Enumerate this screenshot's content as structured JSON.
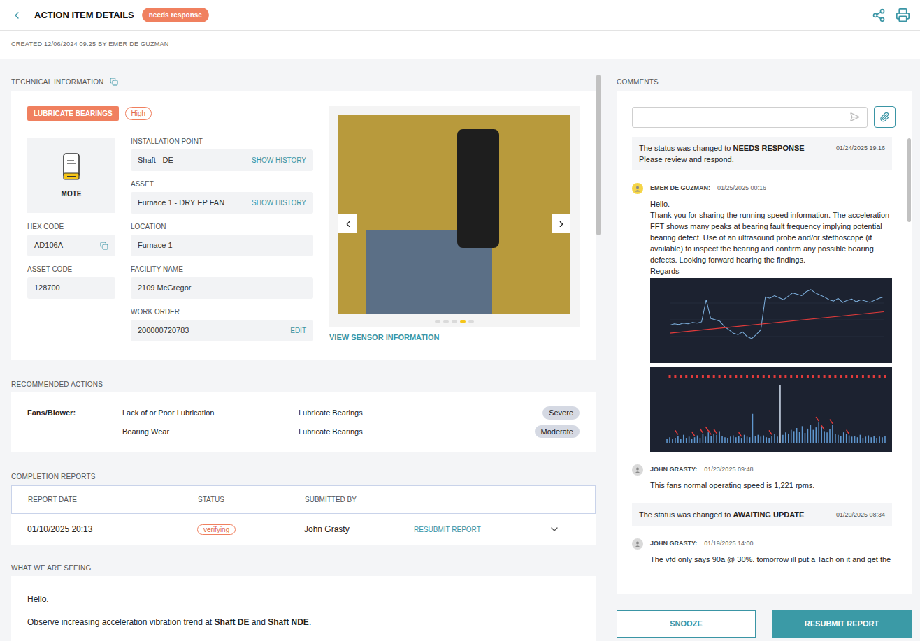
{
  "header": {
    "title": "ACTION ITEM DETAILS",
    "status": "needs response"
  },
  "created": "CREATED 12/06/2024 09:25 BY EMER DE GUZMAN",
  "technical": {
    "label": "TECHNICAL INFORMATION",
    "action": "LUBRICATE BEARINGS",
    "priority": "High",
    "device": "MOTE",
    "left_fields": [
      {
        "label": "HEX CODE",
        "value": "AD106A",
        "copyable": true
      },
      {
        "label": "ASSET CODE",
        "value": "128700",
        "copyable": false
      }
    ],
    "fields": [
      {
        "label": "INSTALLATION POINT",
        "value": "Shaft - DE",
        "link": "SHOW HISTORY"
      },
      {
        "label": "ASSET",
        "value": "Furnace 1 - DRY EP FAN",
        "link": "SHOW HISTORY"
      },
      {
        "label": "LOCATION",
        "value": "Furnace 1",
        "link": ""
      },
      {
        "label": "FACILITY NAME",
        "value": "2109 McGregor",
        "link": ""
      },
      {
        "label": "WORK ORDER",
        "value": "200000720783",
        "link": "EDIT"
      }
    ],
    "photo": {
      "slides": [
        {
          "selected": false
        },
        {
          "selected": false
        },
        {
          "selected": false
        },
        {
          "selected": true
        },
        {
          "selected": false
        }
      ],
      "link": "VIEW SENSOR INFORMATION"
    }
  },
  "recommended": {
    "label": "RECOMMENDED ACTIONS",
    "category": "Fans/Blower:",
    "rows": [
      {
        "issue": "Lack of or Poor Lubrication",
        "action": "Lubricate Bearings",
        "severity": "Severe"
      },
      {
        "issue": "Bearing Wear",
        "action": "Lubricate Bearings",
        "severity": "Moderate"
      }
    ]
  },
  "completion": {
    "label": "COMPLETION REPORTS",
    "columns": [
      "REPORT DATE",
      "STATUS",
      "SUBMITTED BY"
    ],
    "rows": [
      {
        "date": "01/10/2025 20:13",
        "status": "verifying",
        "submitted_by": "John Grasty",
        "action": "RESUBMIT REPORT",
        "expanded": false
      }
    ]
  },
  "seeing": {
    "label": "WHAT WE ARE SEEING",
    "greeting": "Hello.",
    "segments": [
      {
        "text": "Observe increasing acceleration vibration trend at ",
        "bold": false
      },
      {
        "text": "Shaft DE",
        "bold": true
      },
      {
        "text": " and ",
        "bold": false
      },
      {
        "text": "Shaft NDE",
        "bold": true
      },
      {
        "text": ".",
        "bold": false
      }
    ]
  },
  "comments": {
    "label": "COMMENTS",
    "input": "",
    "items": [
      {
        "kind": "status",
        "prefix": "The status was changed to ",
        "status": "NEEDS RESPONSE",
        "date": "01/24/2025 19:16",
        "note": "Please review and respond."
      },
      {
        "kind": "user",
        "author": "EMER DE GUZMAN:",
        "date": "01/25/2025 00:16",
        "avatar_color": "#f5d547",
        "paragraphs": [
          "Hello.",
          "Thank you for sharing the running speed information. The acceleration FFT shows many peaks at bearing fault frequency implying potential bearing defect. Use of an ultrasound probe and/or stethoscope (if available) to inspect the bearing and confirm any possible bearing defects. Looking forward hearing the findings.",
          "Regards"
        ],
        "charts": [
          {
            "type": "trend",
            "series": [
              42,
              44,
              43,
              45,
              44,
              46,
              45,
              47,
              80,
              52,
              50,
              48,
              40,
              35,
              30,
              28,
              32,
              25,
              22,
              28,
              35,
              84,
              82,
              86,
              83,
              80,
              85,
              90,
              88,
              86,
              92,
              95,
              90,
              87,
              84,
              80,
              78,
              82,
              76,
              79,
              81,
              77,
              80,
              78,
              76,
              79,
              82,
              84
            ],
            "trend": [
              30,
              62
            ]
          },
          {
            "type": "spectrum",
            "series": [
              8,
              10,
              7,
              9,
              12,
              8,
              14,
              9,
              11,
              8,
              10,
              13,
              9,
              15,
              11,
              18,
              12,
              16,
              14,
              20,
              12,
              10,
              9,
              11,
              13,
              10,
              12,
              9,
              14,
              11,
              10,
              48,
              12,
              14,
              11,
              13,
              10,
              9,
              12,
              15,
              11,
              95,
              14,
              18,
              16,
              22,
              20,
              25,
              19,
              28,
              17,
              24,
              30,
              22,
              26,
              34,
              28,
              20,
              18,
              24,
              30,
              16,
              14,
              12,
              18,
              15,
              13,
              11,
              12,
              10,
              14,
              9,
              11,
              13,
              10,
              12,
              9,
              11,
              10,
              12
            ],
            "arrows": [
              4,
              10,
              13,
              15,
              16,
              18,
              27,
              38,
              55,
              57,
              60,
              66
            ],
            "cursors": [
              1,
              3,
              5,
              7,
              9,
              11,
              13,
              15,
              17,
              19,
              21,
              23,
              25,
              27,
              29,
              31,
              33,
              35,
              37,
              39,
              41,
              43,
              45,
              47,
              49,
              51,
              53,
              55,
              57,
              59,
              61,
              63,
              65,
              67,
              69,
              71,
              73,
              75,
              77,
              79
            ]
          }
        ]
      },
      {
        "kind": "user",
        "author": "JOHN GRASTY:",
        "date": "01/23/2025 09:48",
        "avatar_color": "#d9d9d9",
        "paragraphs": [
          "This fans normal operating speed is 1,221 rpms."
        ],
        "charts": []
      },
      {
        "kind": "status",
        "prefix": "The status was changed to ",
        "status": "AWAITING UPDATE",
        "date": "01/20/2025 08:34",
        "note": ""
      },
      {
        "kind": "user",
        "author": "JOHN GRASTY:",
        "date": "01/19/2025 14:00",
        "avatar_color": "#d9d9d9",
        "paragraphs": [
          "The vfd only says 90a @ 30%. tomorrow ill put a Tach on it and get the"
        ],
        "charts": []
      }
    ]
  },
  "buttons": [
    {
      "label": "SNOOZE",
      "primary": false
    },
    {
      "label": "RESUBMIT REPORT",
      "primary": true
    }
  ]
}
